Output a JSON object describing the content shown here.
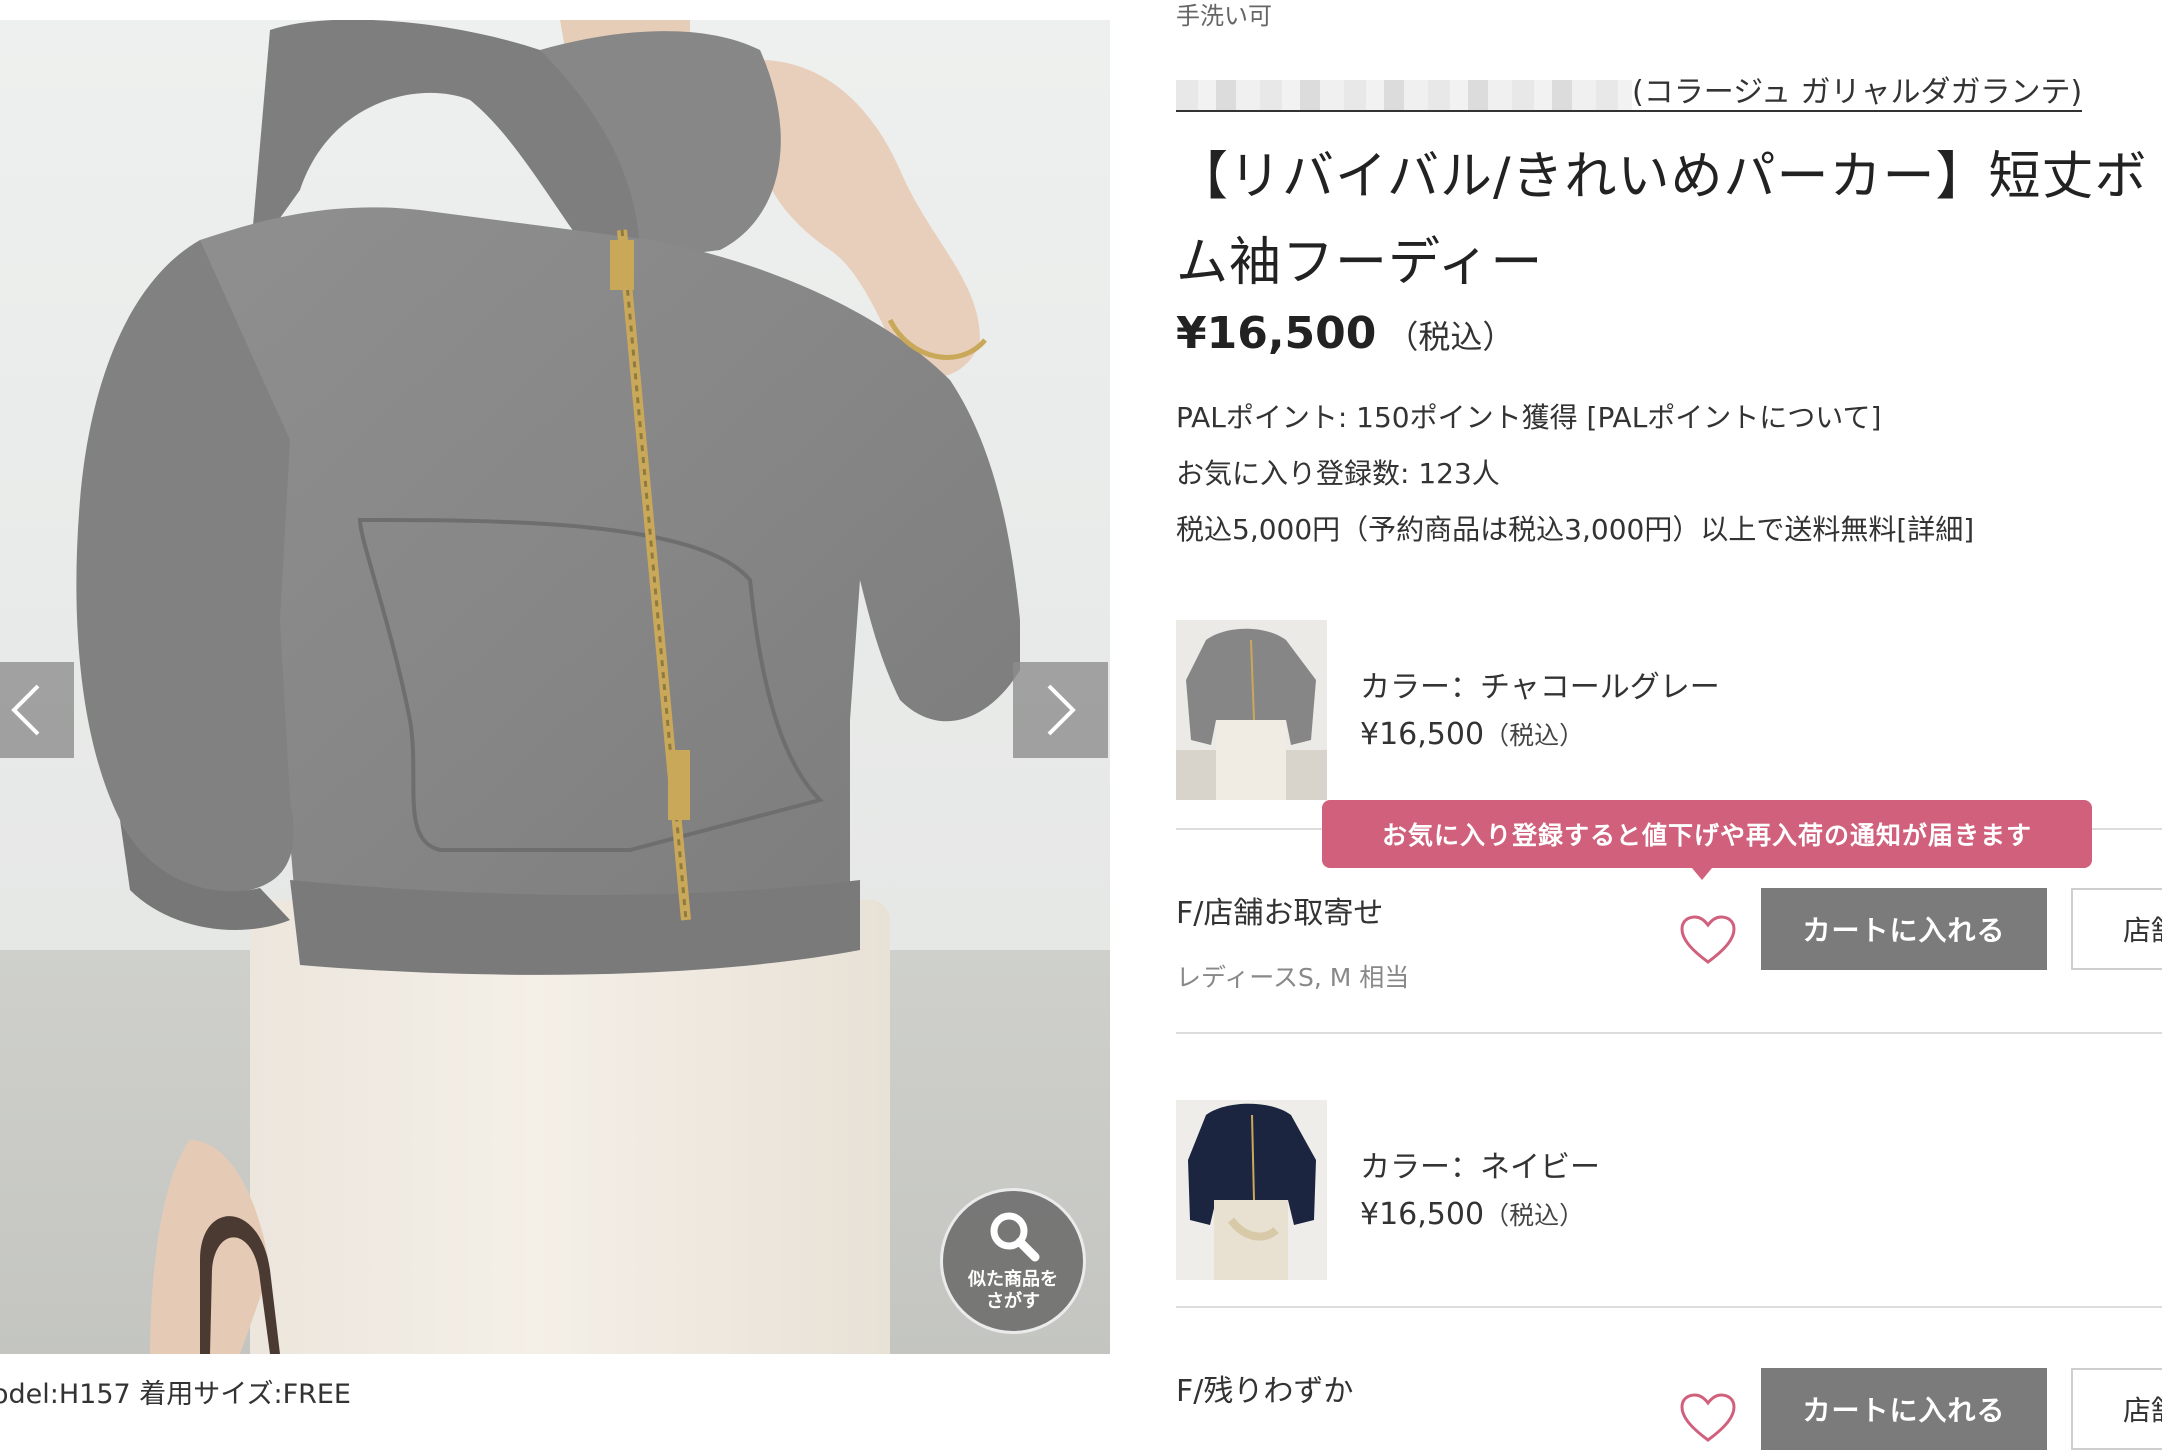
{
  "gallery": {
    "similar_label_line1": "似た商品を",
    "similar_label_line2": "さがす",
    "model_caption": "odel:H157 着用サイズ:FREE",
    "colors": {
      "hoodie": "#8a8a8a",
      "zipper": "#c9a85a"
    }
  },
  "product": {
    "top_cut_text": "手洗い可",
    "brand_name": "(コラージュ ガリャルダガランテ)",
    "title_line1": "【リバイバル/きれいめパーカー】短丈ボ",
    "title_line2": "ム袖フーディー",
    "price": "¥16,500",
    "tax_label": "（税込）",
    "points_text": "PALポイント: 150ポイント獲得 [PALポイントについて]",
    "favorites_text": "お気に入り登録数: 123人",
    "shipping_text": "税込5,000円（予約商品は税込3,000円）以上で送料無料[詳細]"
  },
  "tooltip": "お気に入り登録すると値下げや再入荷の通知が届きます",
  "variants": [
    {
      "color_label": "カラー：チャコールグレー",
      "price": "¥16,500",
      "tax": "（税込）",
      "size_label": "F/店舗お取寄せ",
      "size_note": "レディースS, M 相当",
      "cart_label": "カートに入れる",
      "store_label": "店舗"
    },
    {
      "color_label": "カラー：ネイビー",
      "price": "¥16,500",
      "tax": "（税込）",
      "size_label": "F/残りわずか",
      "cart_label": "カートに入れる",
      "store_label": "店舗"
    }
  ],
  "colors": {
    "accent_pink": "#d0607c",
    "cart_gray": "#7b7b7b",
    "navy": "#1c2540"
  }
}
